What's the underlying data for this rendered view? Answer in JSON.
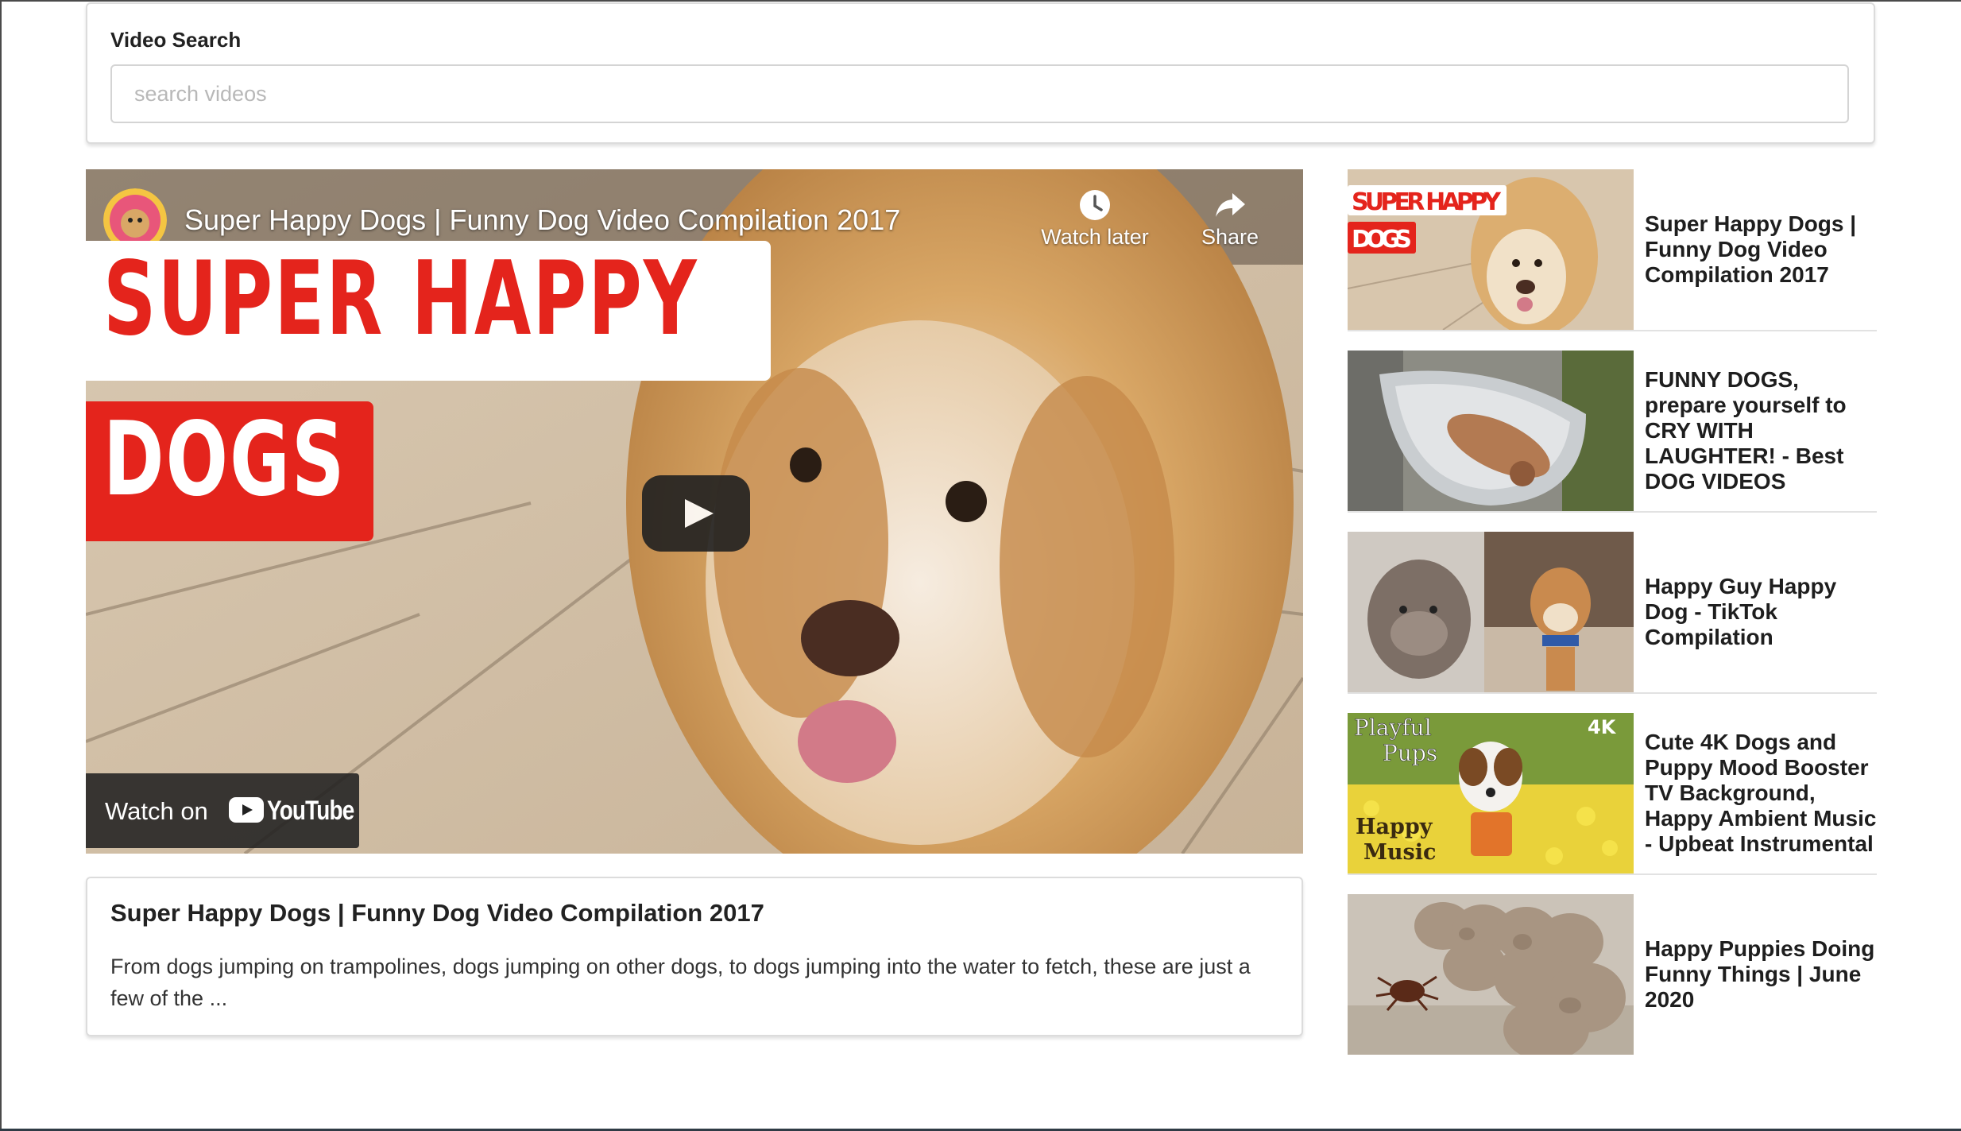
{
  "search": {
    "label": "Video Search",
    "placeholder": "search videos",
    "value": ""
  },
  "player": {
    "title": "Super Happy Dogs | Funny Dog Video Compilation 2017",
    "watch_later_label": "Watch later",
    "share_label": "Share",
    "banner_line1": "SUPER HAPPY",
    "banner_line2": "DOGS",
    "watch_on_label": "Watch on",
    "youtube_label": "YouTube",
    "icons": {
      "watch_later": "clock-icon",
      "share": "share-arrow-icon",
      "play": "play-icon",
      "youtube": "youtube-logo-icon"
    }
  },
  "selected_video": {
    "title": "Super Happy Dogs | Funny Dog Video Compilation 2017",
    "description": "From dogs jumping on trampolines, dogs jumping on other dogs, to dogs jumping into the water to fetch, these are just a few of the ..."
  },
  "video_list": [
    {
      "title": "Super Happy Dogs | Funny Dog Video Compilation 2017",
      "thumb_text_1": "SUPER HAPPY",
      "thumb_text_2": "DOGS"
    },
    {
      "title": "FUNNY DOGS, prepare yourself to CRY WITH LAUGHTER! - Best DOG VIDEOS"
    },
    {
      "title": "Happy Guy Happy Dog - TikTok Compilation"
    },
    {
      "title": "Cute 4K Dogs and Puppy Mood Booster TV Background, Happy Ambient Music - Upbeat Instrumental",
      "thumb_text_1": "Playful",
      "thumb_text_2": "Pups",
      "thumb_text_3": "Happy",
      "thumb_text_4": "Music",
      "thumb_text_5": "4K"
    },
    {
      "title": "Happy Puppies Doing Funny Things | June 2020"
    }
  ],
  "colors": {
    "accent_red": "#e4241c",
    "border": "#dcdcdc",
    "frame": "#2f3b45"
  }
}
